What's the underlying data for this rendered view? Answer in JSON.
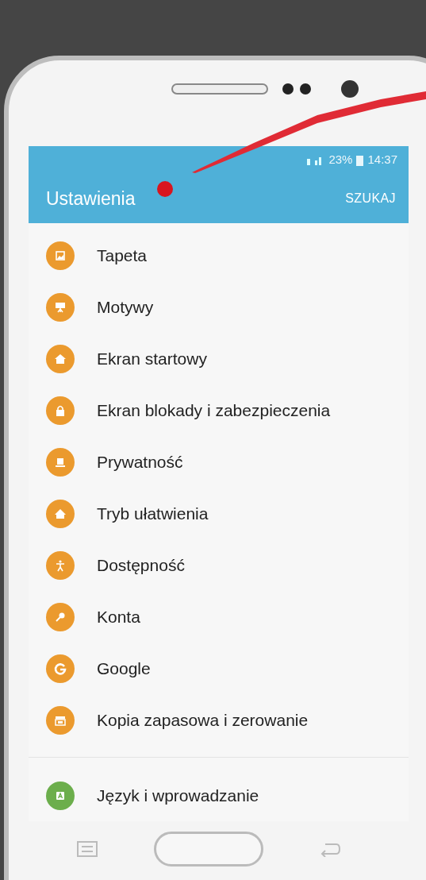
{
  "status_bar": {
    "battery": "23%",
    "time": "14:37"
  },
  "app_bar": {
    "title": "Ustawienia",
    "action": "SZUKAJ"
  },
  "settings": [
    {
      "label": "Tapeta",
      "color": "#eb9a2e"
    },
    {
      "label": "Motywy",
      "color": "#eb9a2e"
    },
    {
      "label": "Ekran startowy",
      "color": "#eb9a2e"
    },
    {
      "label": "Ekran blokady i zabezpieczenia",
      "color": "#eb9a2e"
    },
    {
      "label": "Prywatność",
      "color": "#eb9a2e"
    },
    {
      "label": "Tryb ułatwienia",
      "color": "#eb9a2e"
    },
    {
      "label": "Dostępność",
      "color": "#eb9a2e"
    },
    {
      "label": "Konta",
      "color": "#eb9a2e"
    },
    {
      "label": "Google",
      "color": "#eb9a2e"
    },
    {
      "label": "Kopia zapasowa i zerowanie",
      "color": "#eb9a2e"
    },
    {
      "label": "Język i wprowadzanie",
      "color": "#6cae4c"
    }
  ]
}
